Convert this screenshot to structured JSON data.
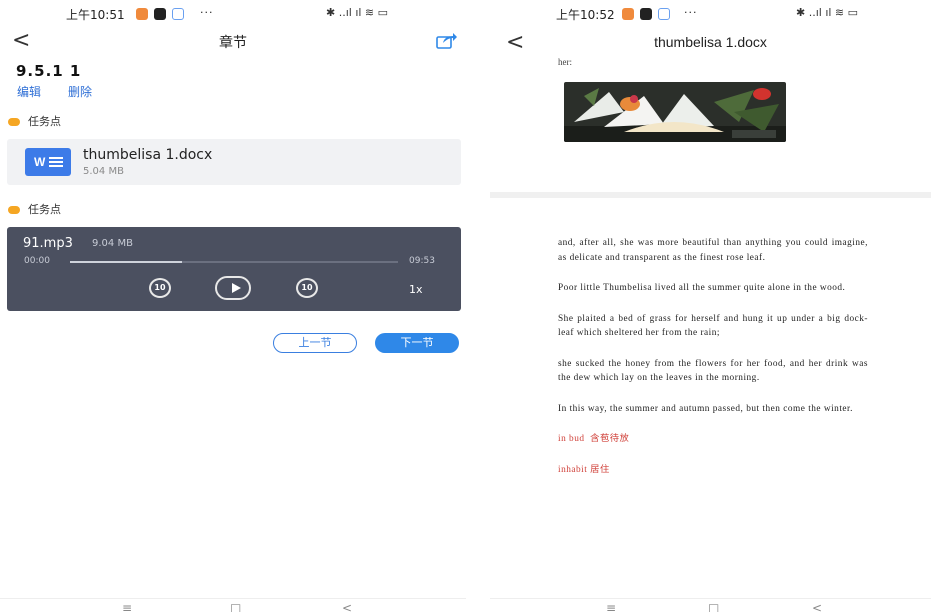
{
  "left": {
    "status": {
      "time": "上午10:51",
      "dots": "···"
    },
    "nav": {
      "back": "<",
      "title": "章节"
    },
    "section_name": "9.5.1 1",
    "actions": {
      "edit": "编辑",
      "delete": "删除"
    },
    "tasks": [
      "任务点",
      "任务点"
    ],
    "file": {
      "icon_letter": "W",
      "name": "thumbelisa 1.docx",
      "size": "5.04 MB"
    },
    "audio": {
      "name": "91.mp3",
      "size": "9.04 MB",
      "current_time": "00:00",
      "duration": "09:53",
      "progress": 0.34,
      "rewind_label": "10",
      "forward_label": "10",
      "speed": "1x"
    },
    "buttons": {
      "prev": "上一节",
      "next": "下一节"
    },
    "sysnav": {
      "menu": "≡",
      "home": "□",
      "back": "<"
    }
  },
  "right": {
    "status": {
      "time": "上午10:52",
      "dots": "···"
    },
    "nav": {
      "back": "<",
      "title": "thumbelisa 1.docx"
    },
    "top_text": "her:",
    "paragraphs": [
      "and, after all, she was more beautiful than anything you could imagine, as delicate and transparent as the finest rose leaf.",
      "Poor little Thumbelisa lived all the summer quite alone in the wood.",
      "She plaited a bed of grass for herself and hung it up under a big dock-leaf which sheltered her from the rain;",
      "she sucked the honey from the flowers for her food, and her drink was the dew which lay on the leaves in the morning.",
      "In this way, the summer and autumn passed, but then come the winter."
    ],
    "vocab": [
      "in bud  含苞待放",
      "inhabit 居住"
    ],
    "sysnav": {
      "menu": "≡",
      "home": "□",
      "back": "<"
    }
  },
  "colors": {
    "accent": "#2f88e8",
    "task_dot": "#f5a623",
    "player_bg": "#4b5060",
    "vocab_red": "#d0413a"
  }
}
